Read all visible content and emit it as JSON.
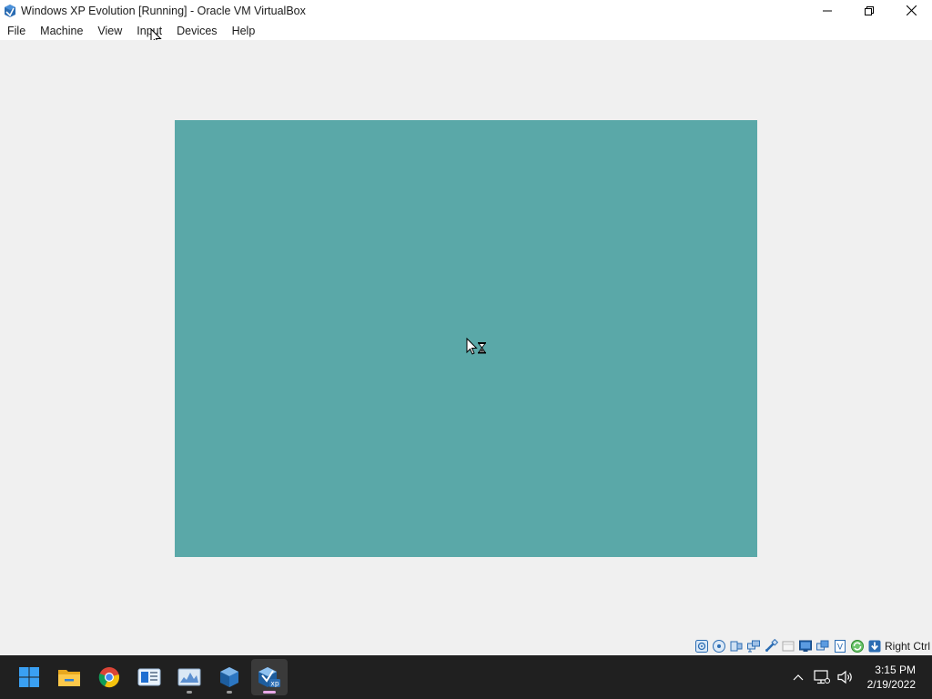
{
  "window": {
    "title": "Windows XP Evolution [Running] - Oracle VM VirtualBox"
  },
  "menu": {
    "items": [
      "File",
      "Machine",
      "View",
      "Input",
      "Devices",
      "Help"
    ]
  },
  "guest": {
    "background_color": "#5aa8a8",
    "cursor": "busy-hourglass-cursor-icon"
  },
  "statusbar": {
    "icons": [
      "hard-disk-icon",
      "optical-drive-icon",
      "audio-icon",
      "network-icon",
      "usb-icon",
      "shared-folders-icon",
      "display-icon",
      "video-capture-icon",
      "virtualization-icon",
      "mouse-integration-icon",
      "keyboard-capture-icon"
    ],
    "host_key": "Right Ctrl"
  },
  "taskbar": {
    "apps": [
      "start-button",
      "file-explorer",
      "chrome",
      "news-app",
      "performance-monitor",
      "virtualbox-manager",
      "windows-xp-vm"
    ],
    "clock": {
      "time": "3:15 PM",
      "date": "2/19/2022"
    }
  }
}
